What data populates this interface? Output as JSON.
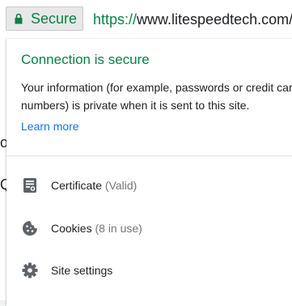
{
  "omnibox": {
    "security_chip_label": "Secure",
    "url_scheme": "https://",
    "url_host": "www.litespeedtech.com/s"
  },
  "background_fragments": [
    "o",
    "Q"
  ],
  "popup": {
    "title": "Connection is secure",
    "description": "Your information (for example, passwords or credit card numbers) is private when it is sent to this site.",
    "learn_more": "Learn more",
    "items": [
      {
        "label": "Certificate",
        "detail": "(Valid)",
        "icon": "certificate-icon"
      },
      {
        "label": "Cookies",
        "detail": "(8 in use)",
        "icon": "cookie-icon"
      },
      {
        "label": "Site settings",
        "detail": "",
        "icon": "gear-icon"
      }
    ]
  },
  "colors": {
    "secure_green": "#0b8043",
    "link_blue": "#1a73e8",
    "text": "#202124",
    "muted": "#757575"
  }
}
